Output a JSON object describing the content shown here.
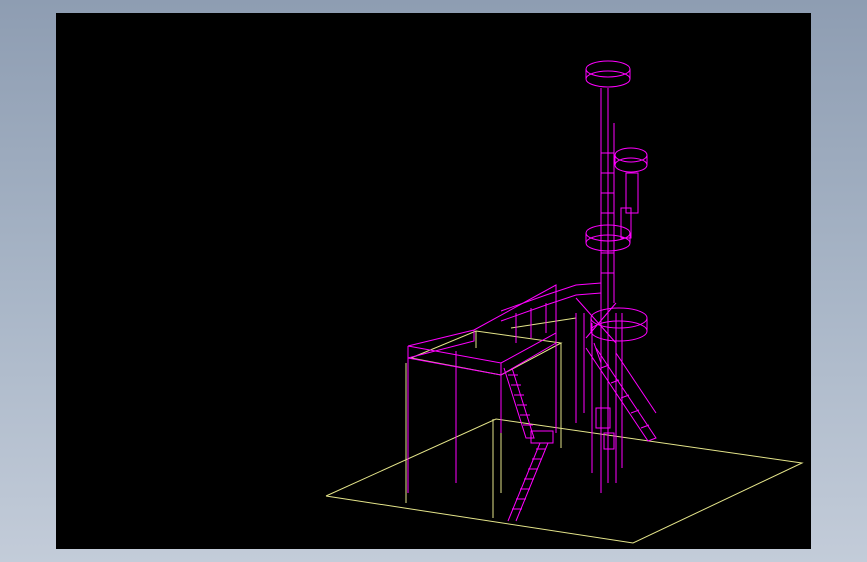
{
  "viewport": {
    "background": "#000000",
    "model_color": "#ff00ff",
    "ground_color": "#e5e58a",
    "frame_color": "#e5e58a",
    "render_style": "wireframe"
  },
  "page": {
    "background_top": "#8e9db2",
    "background_bottom": "#c3ccd9"
  }
}
